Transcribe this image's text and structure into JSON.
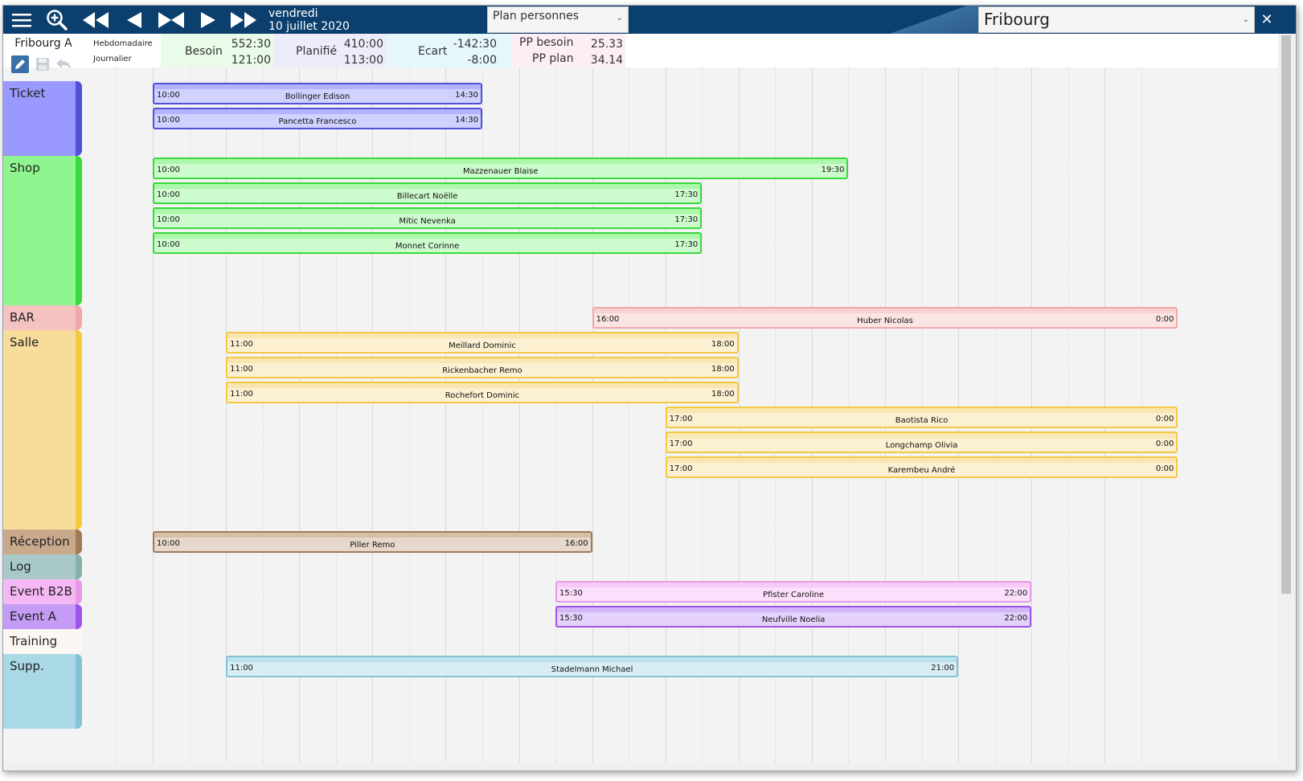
{
  "toolbar": {
    "day": "vendredi",
    "date": "10 juillet 2020",
    "plan_select": "Plan personnes",
    "city": "Fribourg"
  },
  "stats": {
    "team": "Fribourg A",
    "period_weekly": "Hebdomadaire",
    "period_daily": "Journalier",
    "besoin_label": "Besoin",
    "besoin_week": "552:30",
    "besoin_day": "121:00",
    "planifie_label": "Planifié",
    "planifie_week": "410:00",
    "planifie_day": "113:00",
    "ecart_label": "Ecart",
    "ecart_week": "-142:30",
    "ecart_day": "-8:00",
    "pp_besoin_label": "PP besoin",
    "pp_besoin": "25.33",
    "pp_plan_label": "PP plan",
    "pp_plan": "34.14"
  },
  "departments": [
    {
      "name": "Ticket",
      "color": "#9999ff",
      "edge": "#5050d8"
    },
    {
      "name": "Shop",
      "color": "#8ff58f",
      "edge": "#3ad83a"
    },
    {
      "name": "BAR",
      "color": "#f5c2c2",
      "edge": "#f0a8a8"
    },
    {
      "name": "Salle",
      "color": "#f7dd99",
      "edge": "#f5c842"
    },
    {
      "name": "Réception",
      "color": "#c8a98c",
      "edge": "#a07a56"
    },
    {
      "name": "Log",
      "color": "#a9c9c9",
      "edge": "#86b0b0"
    },
    {
      "name": "Event B2B",
      "color": "#f5b8f5",
      "edge": "#e89ae8"
    },
    {
      "name": "Event A",
      "color": "#c49cf5",
      "edge": "#9c55e8"
    },
    {
      "name": "Training",
      "color": "#fdf7f3",
      "edge": "#fdf7f3"
    },
    {
      "name": "Supp.",
      "color": "#aad9e6",
      "edge": "#84c3d6"
    }
  ],
  "shifts": [
    {
      "start": "10:00",
      "end": "14:30",
      "name": "Bollinger Edison",
      "dept": 0
    },
    {
      "start": "10:00",
      "end": "14:30",
      "name": "Pancetta Francesco",
      "dept": 0
    },
    {
      "start": "10:00",
      "end": "19:30",
      "name": "Mazzenauer Blaise",
      "dept": 1
    },
    {
      "start": "10:00",
      "end": "17:30",
      "name": "Billecart Noëlle",
      "dept": 1
    },
    {
      "start": "10:00",
      "end": "17:30",
      "name": "Mitic Nevenka",
      "dept": 1
    },
    {
      "start": "10:00",
      "end": "17:30",
      "name": "Monnet Corinne",
      "dept": 1
    },
    {
      "start": "16:00",
      "end": "0:00",
      "name": "Huber Nicolas",
      "dept": 2
    },
    {
      "start": "11:00",
      "end": "18:00",
      "name": "Meillard Dominic",
      "dept": 3
    },
    {
      "start": "11:00",
      "end": "18:00",
      "name": "Rickenbacher Remo",
      "dept": 3
    },
    {
      "start": "11:00",
      "end": "18:00",
      "name": "Rochefort Dominic",
      "dept": 3
    },
    {
      "start": "17:00",
      "end": "0:00",
      "name": "Baotista Rico",
      "dept": 3
    },
    {
      "start": "17:00",
      "end": "0:00",
      "name": "Longchamp Olivia",
      "dept": 3
    },
    {
      "start": "17:00",
      "end": "0:00",
      "name": "Karembeu André",
      "dept": 3
    },
    {
      "start": "10:00",
      "end": "16:00",
      "name": "Piller Remo",
      "dept": 4
    },
    {
      "start": "15:30",
      "end": "22:00",
      "name": "Pfister Caroline",
      "dept": 6
    },
    {
      "start": "15:30",
      "end": "22:00",
      "name": "Neufville Noelia",
      "dept": 7
    },
    {
      "start": "11:00",
      "end": "21:00",
      "name": "Stadelmann Michael",
      "dept": 9
    }
  ]
}
